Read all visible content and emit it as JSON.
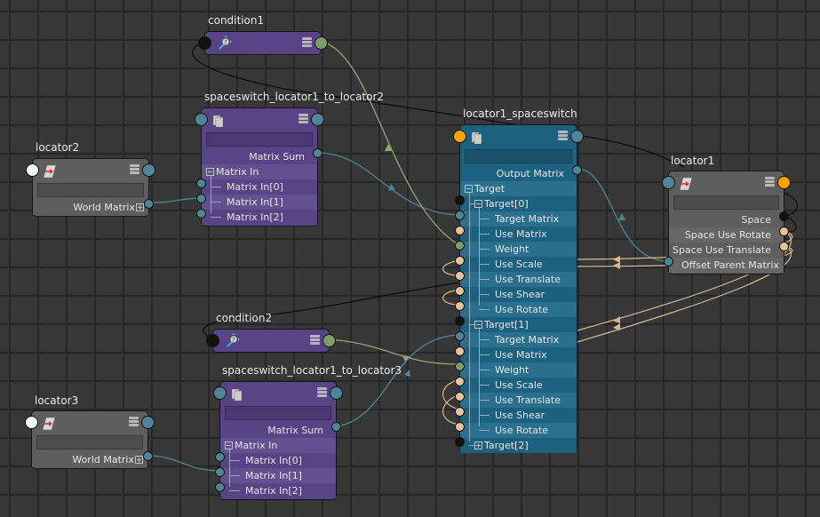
{
  "editor": "Node Editor",
  "colors": {
    "port_matrix": "#4e8597",
    "port_bool": "#e7c29a",
    "port_weight": "#7c9d68",
    "port_message": "#111111",
    "port_output_orange": "#f6a300",
    "port_input_white": "#f5f5f5",
    "wire_matrix": "#4e8597",
    "wire_bool": "#d9b88f",
    "wire_weight": "#8fa877",
    "wire_message": "#0c0c0c"
  },
  "nodes": {
    "condition1": {
      "title": "condition1",
      "type": "condition",
      "icon": "condition-icon"
    },
    "condition2": {
      "title": "condition2",
      "type": "condition",
      "icon": "condition-icon"
    },
    "ss2": {
      "title": "spaceswitch_locator1_to_locator2",
      "type": "addMatrix",
      "icon": "matrix-icon",
      "output": "Matrix Sum",
      "group": "Matrix In",
      "inputs": [
        "Matrix In[0]",
        "Matrix In[1]",
        "Matrix In[2]"
      ]
    },
    "ss3": {
      "title": "spaceswitch_locator1_to_locator3",
      "type": "addMatrix",
      "icon": "matrix-icon",
      "output": "Matrix Sum",
      "group": "Matrix In",
      "inputs": [
        "Matrix In[0]",
        "Matrix In[1]",
        "Matrix In[2]"
      ]
    },
    "locator2": {
      "title": "locator2",
      "type": "locator",
      "icon": "locator-icon",
      "output": "World Matrix"
    },
    "locator3": {
      "title": "locator3",
      "type": "locator",
      "icon": "locator-icon",
      "output": "World Matrix"
    },
    "blend": {
      "title": "locator1_spaceswitch",
      "type": "blendMatrix",
      "icon": "matrix-icon",
      "output": "Output Matrix",
      "group": "Target",
      "targets": [
        {
          "label": "Target[0]",
          "expanded": true,
          "attrs": [
            "Target Matrix",
            "Use Matrix",
            "Weight",
            "Use Scale",
            "Use Translate",
            "Use Shear",
            "Use Rotate"
          ]
        },
        {
          "label": "Target[1]",
          "expanded": true,
          "attrs": [
            "Target Matrix",
            "Use Matrix",
            "Weight",
            "Use Scale",
            "Use Translate",
            "Use Shear",
            "Use Rotate"
          ]
        },
        {
          "label": "Target[2]",
          "expanded": false,
          "attrs": []
        }
      ]
    },
    "locator1": {
      "title": "locator1",
      "type": "locator",
      "icon": "locator-icon",
      "attrs": [
        "Space",
        "Space Use Rotate",
        "Space Use Translate",
        "Offset Parent Matrix"
      ]
    }
  }
}
